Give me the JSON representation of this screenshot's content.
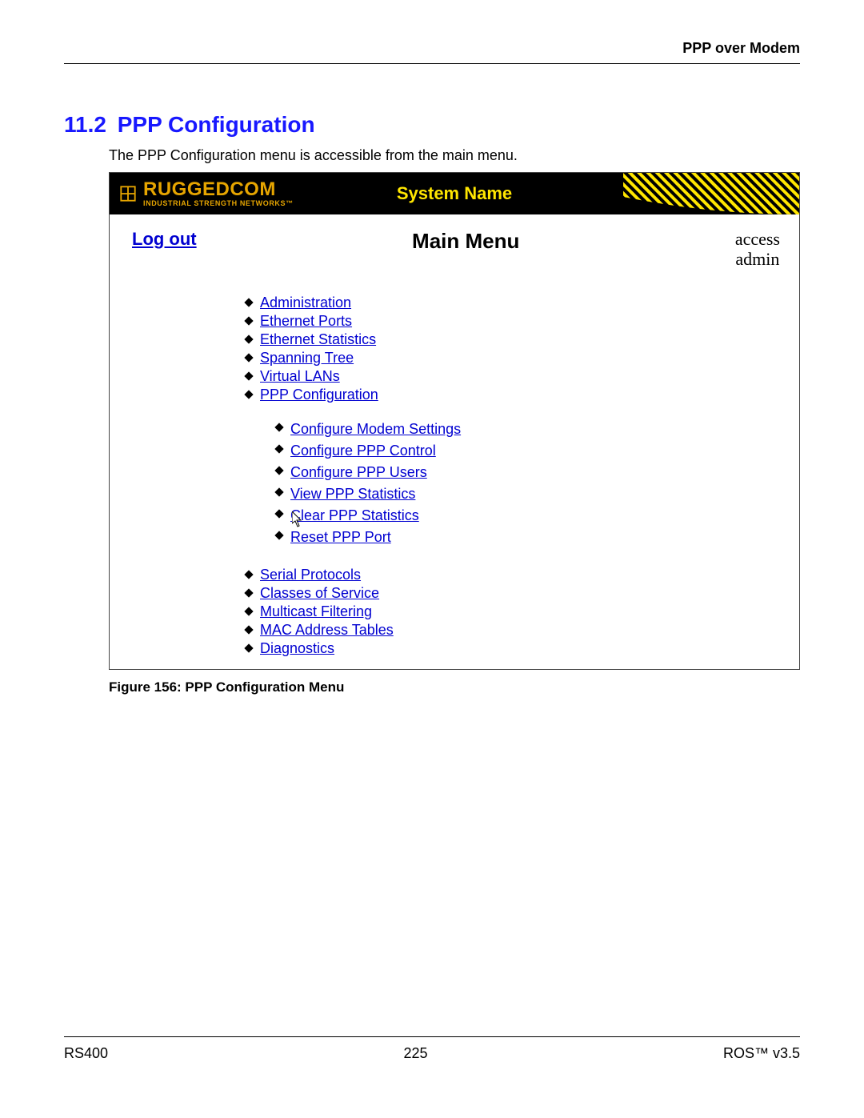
{
  "header": {
    "right": "PPP over Modem"
  },
  "section": {
    "number": "11.2",
    "title": "PPP Configuration",
    "intro": "The PPP Configuration menu is accessible from the main menu."
  },
  "figure": {
    "brand_top": "RUGGEDCOM",
    "brand_bottom": "INDUSTRIAL STRENGTH NETWORKS™",
    "system_name": "System Name",
    "logout": "Log out",
    "main_menu": "Main Menu",
    "access_line1": "access",
    "access_line2": "admin",
    "menu": [
      "Administration",
      "Ethernet Ports",
      "Ethernet Statistics",
      "Spanning Tree",
      "Virtual LANs",
      "PPP Configuration"
    ],
    "submenu": [
      "Configure Modem Settings",
      "Configure PPP Control",
      "Configure PPP Users",
      "View PPP Statistics",
      "Clear PPP Statistics",
      "Reset PPP Port"
    ],
    "menu2": [
      "Serial Protocols",
      "Classes of Service",
      "Multicast Filtering",
      "MAC Address Tables",
      "Diagnostics"
    ],
    "caption": "Figure 156: PPP Configuration Menu"
  },
  "footer": {
    "left": "RS400",
    "center": "225",
    "right": "ROS™  v3.5"
  }
}
